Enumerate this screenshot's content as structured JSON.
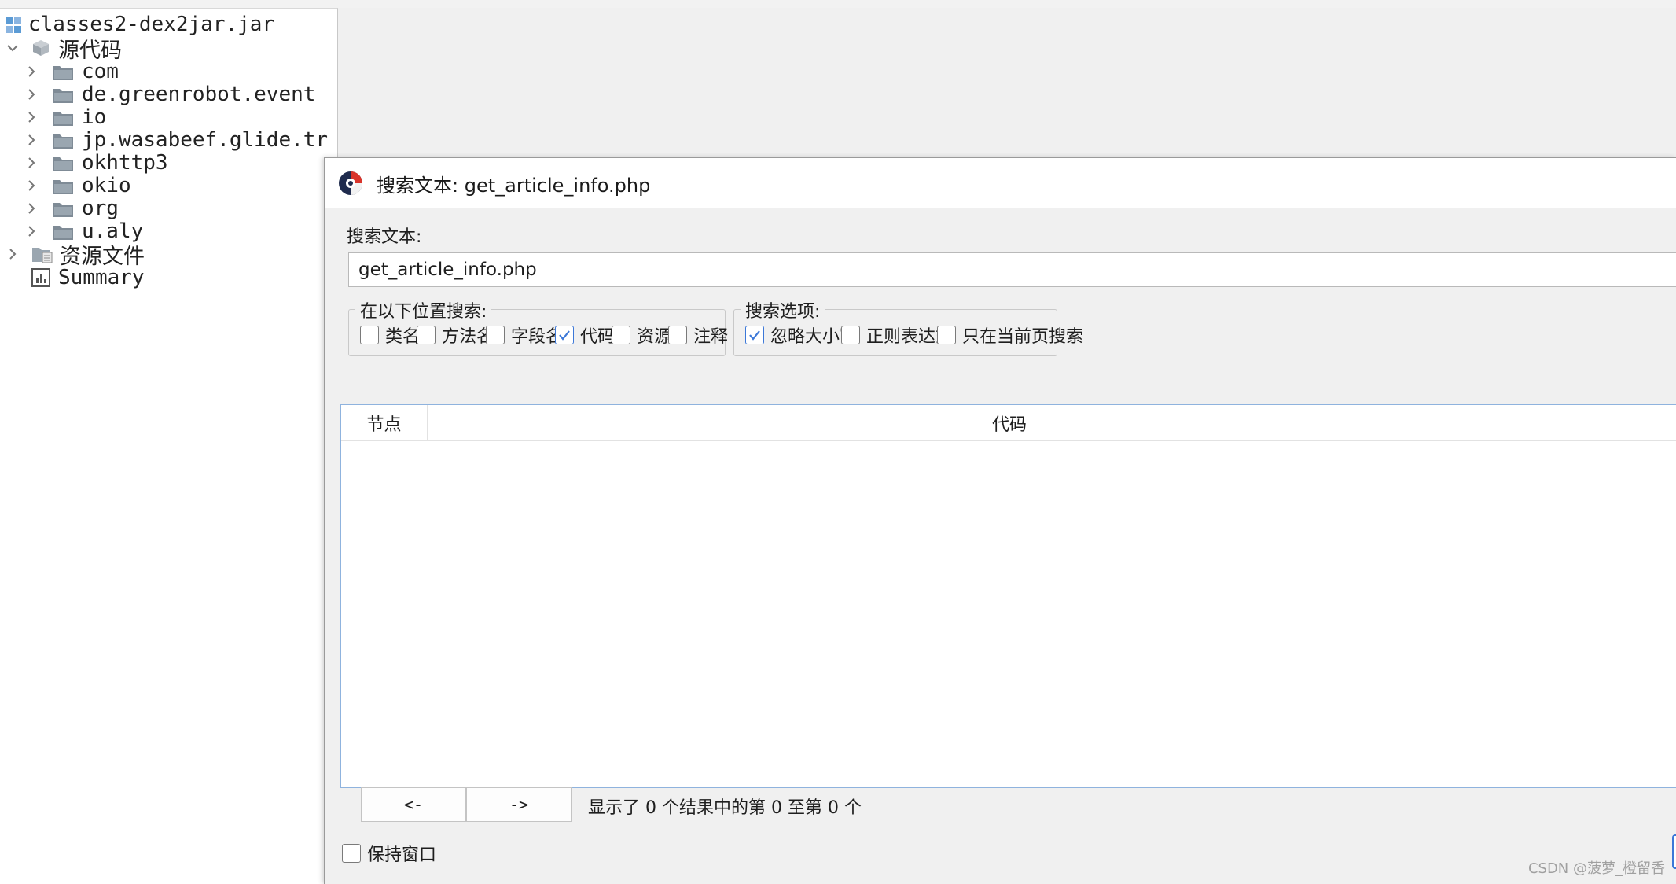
{
  "tree": {
    "root": "classes2-dex2jar.jar",
    "source_node": "源代码",
    "packages": [
      "com",
      "de.greenrobot.event",
      "io",
      "jp.wasabeef.glide.tr",
      "okhttp3",
      "okio",
      "org",
      "u.aly"
    ],
    "resources_node": "资源文件",
    "summary_node": "Summary"
  },
  "dialog": {
    "title": "搜索文本: get_article_info.php",
    "search_label": "搜索文本:",
    "search_value": "get_article_info.php",
    "location_group": {
      "legend": "在以下位置搜索:",
      "options": [
        {
          "label": "类名",
          "checked": false
        },
        {
          "label": "方法名",
          "checked": false
        },
        {
          "label": "字段名",
          "checked": false
        },
        {
          "label": "代码",
          "checked": true
        },
        {
          "label": "资源",
          "checked": false
        },
        {
          "label": "注释",
          "checked": false
        }
      ]
    },
    "options_group": {
      "legend": "搜索选项:",
      "options": [
        {
          "label": "忽略大小写",
          "checked": true
        },
        {
          "label": "正则表达式",
          "checked": false
        },
        {
          "label": "只在当前页搜索",
          "checked": false
        }
      ]
    },
    "results": {
      "columns": [
        "节点",
        "代码"
      ]
    },
    "prev_label": "<-",
    "next_label": "->",
    "status": "显示了 0 个结果中的第 0 至第 0 个",
    "keep_window_label": "保持窗口",
    "keep_window_checked": false
  },
  "watermark": "CSDN @菠萝_橙留香",
  "colors": {
    "accent": "#3c78d8",
    "folder": "#7f8b96",
    "panel_bg": "#ffffff",
    "dialog_bg": "#f0f0f0"
  }
}
